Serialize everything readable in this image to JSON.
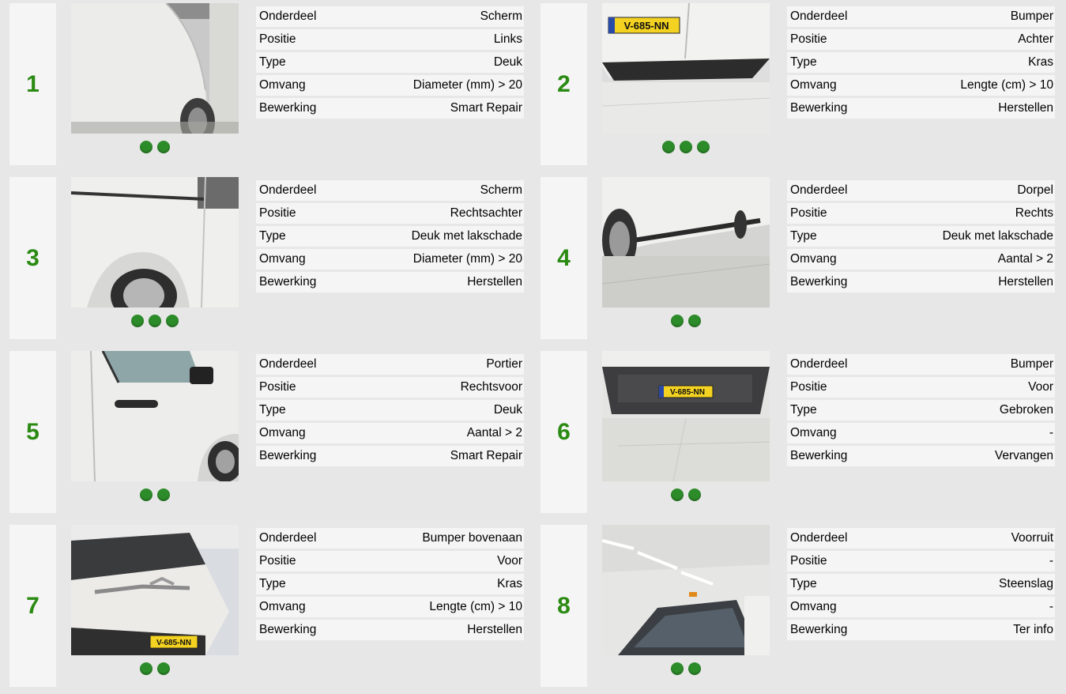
{
  "labels": {
    "part": "Onderdeel",
    "position": "Positie",
    "type": "Type",
    "extent": "Omvang",
    "treatment": "Bewerking"
  },
  "damages": [
    {
      "number": "1",
      "part": "Scherm",
      "position": "Links",
      "type": "Deuk",
      "extent": "Diameter (mm) > 20",
      "treatment": "Smart Repair",
      "photo_count": 2,
      "photo_subject": "rear-left side panel"
    },
    {
      "number": "2",
      "part": "Bumper",
      "position": "Achter",
      "type": "Kras",
      "extent": "Lengte (cm) > 10",
      "treatment": "Herstellen",
      "photo_count": 3,
      "photo_subject": "rear bumper",
      "plate": "V-685-NN"
    },
    {
      "number": "3",
      "part": "Scherm",
      "position": "Rechtsachter",
      "type": "Deuk met lakschade",
      "extent": "Diameter (mm) > 20",
      "treatment": "Herstellen",
      "photo_count": 3,
      "photo_subject": "right rear side panel"
    },
    {
      "number": "4",
      "part": "Dorpel",
      "position": "Rechts",
      "type": "Deuk met lakschade",
      "extent": "Aantal > 2",
      "treatment": "Herstellen",
      "photo_count": 2,
      "photo_subject": "right sill"
    },
    {
      "number": "5",
      "part": "Portier",
      "position": "Rechtsvoor",
      "type": "Deuk",
      "extent": "Aantal > 2",
      "treatment": "Smart Repair",
      "photo_count": 2,
      "photo_subject": "right front door"
    },
    {
      "number": "6",
      "part": "Bumper",
      "position": "Voor",
      "type": "Gebroken",
      "extent": "-",
      "treatment": "Vervangen",
      "photo_count": 2,
      "photo_subject": "front bumper",
      "plate": "V-685-NN"
    },
    {
      "number": "7",
      "part": "Bumper bovenaan",
      "position": "Voor",
      "type": "Kras",
      "extent": "Lengte (cm) > 10",
      "treatment": "Herstellen",
      "photo_count": 2,
      "photo_subject": "front bumper top",
      "plate": "V-685-NN"
    },
    {
      "number": "8",
      "part": "Voorruit",
      "position": "-",
      "type": "Steenslag",
      "extent": "-",
      "treatment": "Ter info",
      "photo_count": 2,
      "photo_subject": "windscreen"
    }
  ],
  "colors": {
    "number": "#2a8a12",
    "dot": "#2d8c2a",
    "background": "#e7e7e7",
    "cell": "#f5f5f5"
  }
}
